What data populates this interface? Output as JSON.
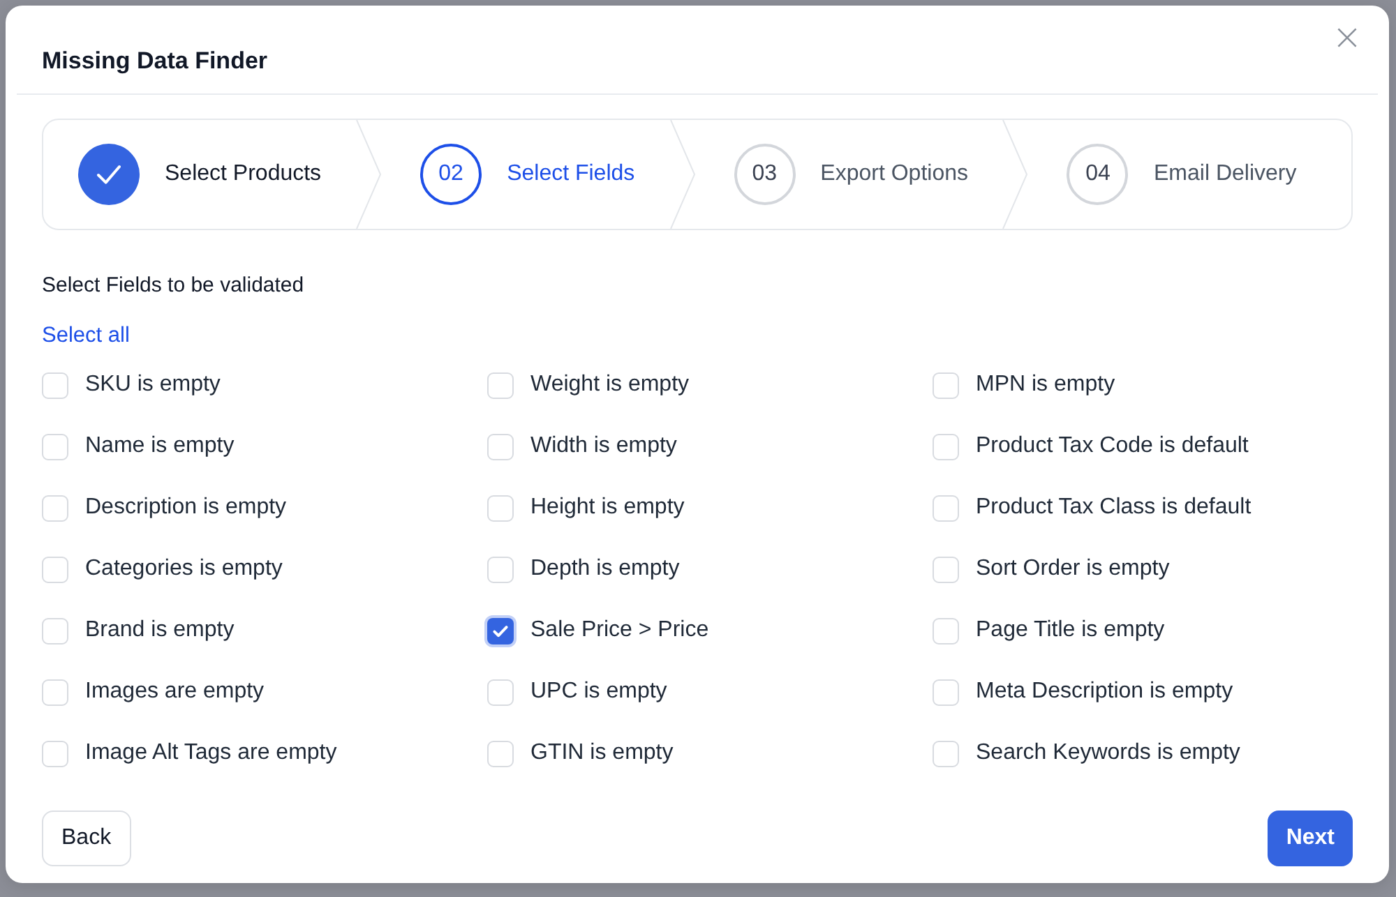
{
  "dialog": {
    "title": "Missing Data Finder"
  },
  "steps": [
    {
      "label": "Select Products",
      "completed": true,
      "selected": false
    },
    {
      "number": "02",
      "label": "Select Fields",
      "completed": false,
      "selected": true
    },
    {
      "number": "03",
      "label": "Export Options",
      "completed": false,
      "selected": false
    },
    {
      "number": "04",
      "label": "Email Delivery",
      "completed": false,
      "selected": false
    }
  ],
  "fields_section": {
    "heading": "Select Fields to be validated",
    "select_all": "Select all",
    "columns": [
      {
        "fields": [
          {
            "label": "SKU is empty",
            "checked": false
          },
          {
            "label": "Name is empty",
            "checked": false
          },
          {
            "label": "Description is empty",
            "checked": false
          },
          {
            "label": "Categories is empty",
            "checked": false
          },
          {
            "label": "Brand is empty",
            "checked": false
          },
          {
            "label": "Images are empty",
            "checked": false
          },
          {
            "label": "Image Alt Tags are empty",
            "checked": false
          }
        ]
      },
      {
        "fields": [
          {
            "label": "Weight is empty",
            "checked": false
          },
          {
            "label": "Width is empty",
            "checked": false
          },
          {
            "label": "Height is empty",
            "checked": false
          },
          {
            "label": "Depth is empty",
            "checked": false
          },
          {
            "label": "Sale Price > Price",
            "checked": true
          },
          {
            "label": "UPC is empty",
            "checked": false
          },
          {
            "label": "GTIN is empty",
            "checked": false
          }
        ]
      },
      {
        "fields": [
          {
            "label": "MPN is empty",
            "checked": false
          },
          {
            "label": "Product Tax Code is default",
            "checked": false
          },
          {
            "label": "Product Tax Class is default",
            "checked": false
          },
          {
            "label": "Sort Order is empty",
            "checked": false
          },
          {
            "label": "Page Title is empty",
            "checked": false
          },
          {
            "label": "Meta Description is empty",
            "checked": false
          },
          {
            "label": "Search Keywords is empty",
            "checked": false
          }
        ]
      }
    ]
  },
  "buttons": [
    {
      "label": "Back",
      "kind": "secondary"
    },
    {
      "label": "Next",
      "kind": "primary"
    }
  ]
}
